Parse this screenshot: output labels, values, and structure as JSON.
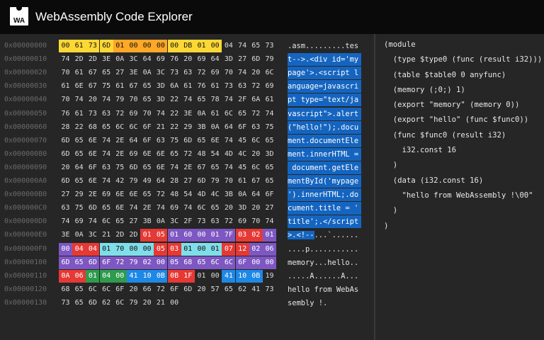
{
  "app": {
    "title": "WebAssembly Code Explorer",
    "logo_text": "WA"
  },
  "colors": {
    "yellow": "#fdd835",
    "orange": "#ffa726",
    "red": "#e53935",
    "purple": "#7e57c2",
    "cyan": "#80deea",
    "green": "#2e9b4d",
    "blue": "#1e88e5",
    "ascii_highlight": "#1565c0"
  },
  "hex_rows": [
    {
      "addr": "0x00000000",
      "bytes": [
        "00",
        "61",
        "73",
        "6D",
        "01",
        "00",
        "00",
        "00",
        "00",
        "DB",
        "01",
        "00",
        "04",
        "74",
        "65",
        "73"
      ],
      "colors": [
        "yellow",
        "yellow",
        "yellow",
        "yellow",
        "orange",
        "orange",
        "orange",
        "orange",
        "yellow",
        "yellow",
        "yellow",
        "yellow",
        "",
        "",
        "",
        ""
      ],
      "ascii": ".asm.........tes",
      "ascii_hl": false
    },
    {
      "addr": "0x00000010",
      "bytes": [
        "74",
        "2D",
        "2D",
        "3E",
        "0A",
        "3C",
        "64",
        "69",
        "76",
        "20",
        "69",
        "64",
        "3D",
        "27",
        "6D",
        "79"
      ],
      "colors": [
        "",
        "",
        "",
        "",
        "",
        "",
        "",
        "",
        "",
        "",
        "",
        "",
        "",
        "",
        "",
        ""
      ],
      "ascii": "t-->.<div id='my",
      "ascii_hl": true
    },
    {
      "addr": "0x00000020",
      "bytes": [
        "70",
        "61",
        "67",
        "65",
        "27",
        "3E",
        "0A",
        "3C",
        "73",
        "63",
        "72",
        "69",
        "70",
        "74",
        "20",
        "6C"
      ],
      "colors": [
        "",
        "",
        "",
        "",
        "",
        "",
        "",
        "",
        "",
        "",
        "",
        "",
        "",
        "",
        "",
        ""
      ],
      "ascii": "page'>.<script l",
      "ascii_hl": true
    },
    {
      "addr": "0x00000030",
      "bytes": [
        "61",
        "6E",
        "67",
        "75",
        "61",
        "67",
        "65",
        "3D",
        "6A",
        "61",
        "76",
        "61",
        "73",
        "63",
        "72",
        "69"
      ],
      "colors": [
        "",
        "",
        "",
        "",
        "",
        "",
        "",
        "",
        "",
        "",
        "",
        "",
        "",
        "",
        "",
        ""
      ],
      "ascii": "anguage=javascri",
      "ascii_hl": true
    },
    {
      "addr": "0x00000040",
      "bytes": [
        "70",
        "74",
        "20",
        "74",
        "79",
        "70",
        "65",
        "3D",
        "22",
        "74",
        "65",
        "78",
        "74",
        "2F",
        "6A",
        "61"
      ],
      "colors": [
        "",
        "",
        "",
        "",
        "",
        "",
        "",
        "",
        "",
        "",
        "",
        "",
        "",
        "",
        "",
        ""
      ],
      "ascii": "pt type=\"text/ja",
      "ascii_hl": true
    },
    {
      "addr": "0x00000050",
      "bytes": [
        "76",
        "61",
        "73",
        "63",
        "72",
        "69",
        "70",
        "74",
        "22",
        "3E",
        "0A",
        "61",
        "6C",
        "65",
        "72",
        "74"
      ],
      "colors": [
        "",
        "",
        "",
        "",
        "",
        "",
        "",
        "",
        "",
        "",
        "",
        "",
        "",
        "",
        "",
        ""
      ],
      "ascii": "vascript\">.alert",
      "ascii_hl": true
    },
    {
      "addr": "0x00000060",
      "bytes": [
        "28",
        "22",
        "68",
        "65",
        "6C",
        "6C",
        "6F",
        "21",
        "22",
        "29",
        "3B",
        "0A",
        "64",
        "6F",
        "63",
        "75"
      ],
      "colors": [
        "",
        "",
        "",
        "",
        "",
        "",
        "",
        "",
        "",
        "",
        "",
        "",
        "",
        "",
        "",
        ""
      ],
      "ascii": "(\"hello!\");.docu",
      "ascii_hl": true
    },
    {
      "addr": "0x00000070",
      "bytes": [
        "6D",
        "65",
        "6E",
        "74",
        "2E",
        "64",
        "6F",
        "63",
        "75",
        "6D",
        "65",
        "6E",
        "74",
        "45",
        "6C",
        "65"
      ],
      "colors": [
        "",
        "",
        "",
        "",
        "",
        "",
        "",
        "",
        "",
        "",
        "",
        "",
        "",
        "",
        "",
        ""
      ],
      "ascii": "ment.documentEle",
      "ascii_hl": true
    },
    {
      "addr": "0x00000080",
      "bytes": [
        "6D",
        "65",
        "6E",
        "74",
        "2E",
        "69",
        "6E",
        "6E",
        "65",
        "72",
        "48",
        "54",
        "4D",
        "4C",
        "20",
        "3D"
      ],
      "colors": [
        "",
        "",
        "",
        "",
        "",
        "",
        "",
        "",
        "",
        "",
        "",
        "",
        "",
        "",
        "",
        ""
      ],
      "ascii": "ment.innerHTML =",
      "ascii_hl": true
    },
    {
      "addr": "0x00000090",
      "bytes": [
        "20",
        "64",
        "6F",
        "63",
        "75",
        "6D",
        "65",
        "6E",
        "74",
        "2E",
        "67",
        "65",
        "74",
        "45",
        "6C",
        "65"
      ],
      "colors": [
        "",
        "",
        "",
        "",
        "",
        "",
        "",
        "",
        "",
        "",
        "",
        "",
        "",
        "",
        "",
        ""
      ],
      "ascii": " document.getEle",
      "ascii_hl": true
    },
    {
      "addr": "0x000000A0",
      "bytes": [
        "6D",
        "65",
        "6E",
        "74",
        "42",
        "79",
        "49",
        "64",
        "28",
        "27",
        "6D",
        "79",
        "70",
        "61",
        "67",
        "65"
      ],
      "colors": [
        "",
        "",
        "",
        "",
        "",
        "",
        "",
        "",
        "",
        "",
        "",
        "",
        "",
        "",
        "",
        ""
      ],
      "ascii": "mentById('mypage",
      "ascii_hl": true
    },
    {
      "addr": "0x000000B0",
      "bytes": [
        "27",
        "29",
        "2E",
        "69",
        "6E",
        "6E",
        "65",
        "72",
        "48",
        "54",
        "4D",
        "4C",
        "3B",
        "0A",
        "64",
        "6F"
      ],
      "colors": [
        "",
        "",
        "",
        "",
        "",
        "",
        "",
        "",
        "",
        "",
        "",
        "",
        "",
        "",
        "",
        ""
      ],
      "ascii": "').innerHTML;.do",
      "ascii_hl": true
    },
    {
      "addr": "0x000000C0",
      "bytes": [
        "63",
        "75",
        "6D",
        "65",
        "6E",
        "74",
        "2E",
        "74",
        "69",
        "74",
        "6C",
        "65",
        "20",
        "3D",
        "20",
        "27"
      ],
      "colors": [
        "",
        "",
        "",
        "",
        "",
        "",
        "",
        "",
        "",
        "",
        "",
        "",
        "",
        "",
        "",
        ""
      ],
      "ascii": "cument.title = '",
      "ascii_hl": true
    },
    {
      "addr": "0x000000D0",
      "bytes": [
        "74",
        "69",
        "74",
        "6C",
        "65",
        "27",
        "3B",
        "0A",
        "3C",
        "2F",
        "73",
        "63",
        "72",
        "69",
        "70",
        "74"
      ],
      "colors": [
        "",
        "",
        "",
        "",
        "",
        "",
        "",
        "",
        "",
        "",
        "",
        "",
        "",
        "",
        "",
        ""
      ],
      "ascii": "title';.</script",
      "ascii_hl": true
    },
    {
      "addr": "0x000000E0",
      "bytes": [
        "3E",
        "0A",
        "3C",
        "21",
        "2D",
        "2D",
        "01",
        "05",
        "01",
        "60",
        "00",
        "01",
        "7F",
        "03",
        "02",
        "01"
      ],
      "colors": [
        "",
        "",
        "",
        "",
        "",
        "",
        "red",
        "red",
        "purple",
        "purple",
        "purple",
        "purple",
        "purple",
        "red",
        "red",
        "purple"
      ],
      "ascii": ">.<!--...`......",
      "ascii_hl": false,
      "ascii_hl_chars": 6
    },
    {
      "addr": "0x000000F0",
      "bytes": [
        "00",
        "04",
        "04",
        "01",
        "70",
        "00",
        "00",
        "05",
        "03",
        "01",
        "00",
        "01",
        "07",
        "12",
        "02",
        "06"
      ],
      "colors": [
        "purple",
        "red",
        "red",
        "cyan",
        "cyan",
        "cyan",
        "cyan",
        "red",
        "red",
        "cyan",
        "cyan",
        "cyan",
        "red",
        "red",
        "purple",
        "purple"
      ],
      "ascii": "....p...........",
      "ascii_hl": false
    },
    {
      "addr": "0x00000100",
      "bytes": [
        "6D",
        "65",
        "6D",
        "6F",
        "72",
        "79",
        "02",
        "00",
        "05",
        "68",
        "65",
        "6C",
        "6C",
        "6F",
        "00",
        "00"
      ],
      "colors": [
        "purple",
        "purple",
        "purple",
        "purple",
        "purple",
        "purple",
        "purple",
        "purple",
        "purple",
        "purple",
        "purple",
        "purple",
        "purple",
        "purple",
        "purple",
        "purple"
      ],
      "ascii": "memory...hello..",
      "ascii_hl": false
    },
    {
      "addr": "0x00000110",
      "bytes": [
        "0A",
        "06",
        "01",
        "04",
        "00",
        "41",
        "10",
        "0B",
        "0B",
        "1F",
        "01",
        "00",
        "41",
        "10",
        "0B",
        "19"
      ],
      "colors": [
        "red",
        "red",
        "green",
        "green",
        "green",
        "blue",
        "blue",
        "blue",
        "red",
        "red",
        "",
        "",
        "blue",
        "blue",
        "blue",
        ""
      ],
      "ascii": ".....A......A...",
      "ascii_hl": false
    },
    {
      "addr": "0x00000120",
      "bytes": [
        "68",
        "65",
        "6C",
        "6C",
        "6F",
        "20",
        "66",
        "72",
        "6F",
        "6D",
        "20",
        "57",
        "65",
        "62",
        "41",
        "73"
      ],
      "colors": [
        "",
        "",
        "",
        "",
        "",
        "",
        "",
        "",
        "",
        "",
        "",
        "",
        "",
        "",
        "",
        ""
      ],
      "ascii": "hello from WebAs",
      "ascii_hl": false
    },
    {
      "addr": "0x00000130",
      "bytes": [
        "73",
        "65",
        "6D",
        "62",
        "6C",
        "79",
        "20",
        "21",
        "00"
      ],
      "colors": [
        "",
        "",
        "",
        "",
        "",
        "",
        "",
        "",
        ""
      ],
      "ascii": "sembly !.",
      "ascii_hl": false
    }
  ],
  "wat_lines": [
    "(module",
    "  (type $type0 (func (result i32)))",
    "  (table $table0 0 anyfunc)",
    "  (memory (;0;) 1)",
    "  (export \"memory\" (memory 0))",
    "  (export \"hello\" (func $func0))",
    "  (func $func0 (result i32)",
    "    i32.const 16",
    "  )",
    "  (data (i32.const 16)",
    "    \"hello from WebAssembly !\\00\"",
    "  )",
    ")"
  ]
}
